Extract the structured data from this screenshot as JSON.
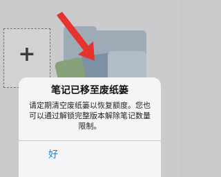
{
  "background": {
    "add_tile": {
      "icon": "plus-icon",
      "label": "+"
    }
  },
  "dialog": {
    "title": "笔记已移至废纸篓",
    "message": "请定期清空废纸篓以恢复额度。您也可以通过解锁完整版本解除笔记数量限制。",
    "ok_label": "好"
  },
  "colors": {
    "accent": "#2f7bd8",
    "arrow": "#e6332d",
    "dialog_bg": "#f5f5f7"
  }
}
